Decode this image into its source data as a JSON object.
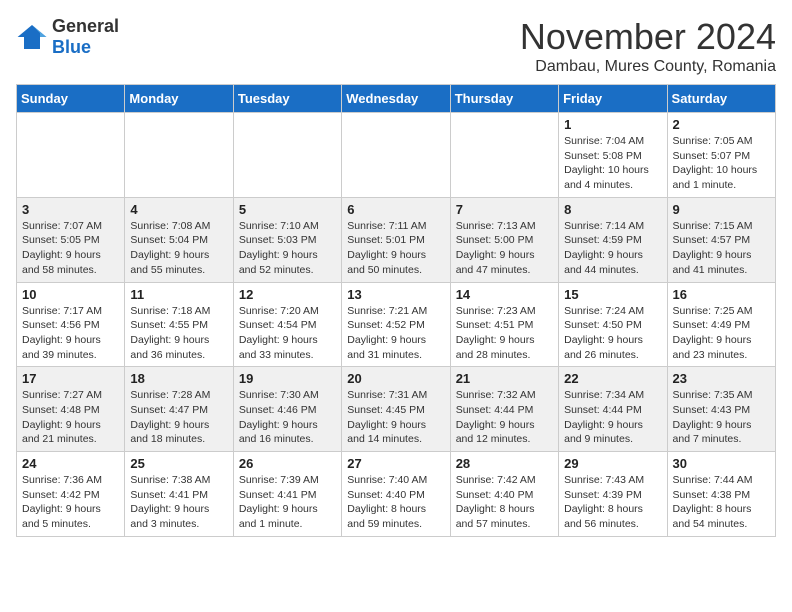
{
  "header": {
    "logo_general": "General",
    "logo_blue": "Blue",
    "month_title": "November 2024",
    "subtitle": "Dambau, Mures County, Romania"
  },
  "weekdays": [
    "Sunday",
    "Monday",
    "Tuesday",
    "Wednesday",
    "Thursday",
    "Friday",
    "Saturday"
  ],
  "weeks": [
    {
      "shaded": false,
      "days": [
        {
          "num": "",
          "detail": "",
          "empty": true
        },
        {
          "num": "",
          "detail": "",
          "empty": true
        },
        {
          "num": "",
          "detail": "",
          "empty": true
        },
        {
          "num": "",
          "detail": "",
          "empty": true
        },
        {
          "num": "",
          "detail": "",
          "empty": true
        },
        {
          "num": "1",
          "detail": "Sunrise: 7:04 AM\nSunset: 5:08 PM\nDaylight: 10 hours and 4 minutes.",
          "empty": false
        },
        {
          "num": "2",
          "detail": "Sunrise: 7:05 AM\nSunset: 5:07 PM\nDaylight: 10 hours and 1 minute.",
          "empty": false
        }
      ]
    },
    {
      "shaded": true,
      "days": [
        {
          "num": "3",
          "detail": "Sunrise: 7:07 AM\nSunset: 5:05 PM\nDaylight: 9 hours and 58 minutes.",
          "empty": false
        },
        {
          "num": "4",
          "detail": "Sunrise: 7:08 AM\nSunset: 5:04 PM\nDaylight: 9 hours and 55 minutes.",
          "empty": false
        },
        {
          "num": "5",
          "detail": "Sunrise: 7:10 AM\nSunset: 5:03 PM\nDaylight: 9 hours and 52 minutes.",
          "empty": false
        },
        {
          "num": "6",
          "detail": "Sunrise: 7:11 AM\nSunset: 5:01 PM\nDaylight: 9 hours and 50 minutes.",
          "empty": false
        },
        {
          "num": "7",
          "detail": "Sunrise: 7:13 AM\nSunset: 5:00 PM\nDaylight: 9 hours and 47 minutes.",
          "empty": false
        },
        {
          "num": "8",
          "detail": "Sunrise: 7:14 AM\nSunset: 4:59 PM\nDaylight: 9 hours and 44 minutes.",
          "empty": false
        },
        {
          "num": "9",
          "detail": "Sunrise: 7:15 AM\nSunset: 4:57 PM\nDaylight: 9 hours and 41 minutes.",
          "empty": false
        }
      ]
    },
    {
      "shaded": false,
      "days": [
        {
          "num": "10",
          "detail": "Sunrise: 7:17 AM\nSunset: 4:56 PM\nDaylight: 9 hours and 39 minutes.",
          "empty": false
        },
        {
          "num": "11",
          "detail": "Sunrise: 7:18 AM\nSunset: 4:55 PM\nDaylight: 9 hours and 36 minutes.",
          "empty": false
        },
        {
          "num": "12",
          "detail": "Sunrise: 7:20 AM\nSunset: 4:54 PM\nDaylight: 9 hours and 33 minutes.",
          "empty": false
        },
        {
          "num": "13",
          "detail": "Sunrise: 7:21 AM\nSunset: 4:52 PM\nDaylight: 9 hours and 31 minutes.",
          "empty": false
        },
        {
          "num": "14",
          "detail": "Sunrise: 7:23 AM\nSunset: 4:51 PM\nDaylight: 9 hours and 28 minutes.",
          "empty": false
        },
        {
          "num": "15",
          "detail": "Sunrise: 7:24 AM\nSunset: 4:50 PM\nDaylight: 9 hours and 26 minutes.",
          "empty": false
        },
        {
          "num": "16",
          "detail": "Sunrise: 7:25 AM\nSunset: 4:49 PM\nDaylight: 9 hours and 23 minutes.",
          "empty": false
        }
      ]
    },
    {
      "shaded": true,
      "days": [
        {
          "num": "17",
          "detail": "Sunrise: 7:27 AM\nSunset: 4:48 PM\nDaylight: 9 hours and 21 minutes.",
          "empty": false
        },
        {
          "num": "18",
          "detail": "Sunrise: 7:28 AM\nSunset: 4:47 PM\nDaylight: 9 hours and 18 minutes.",
          "empty": false
        },
        {
          "num": "19",
          "detail": "Sunrise: 7:30 AM\nSunset: 4:46 PM\nDaylight: 9 hours and 16 minutes.",
          "empty": false
        },
        {
          "num": "20",
          "detail": "Sunrise: 7:31 AM\nSunset: 4:45 PM\nDaylight: 9 hours and 14 minutes.",
          "empty": false
        },
        {
          "num": "21",
          "detail": "Sunrise: 7:32 AM\nSunset: 4:44 PM\nDaylight: 9 hours and 12 minutes.",
          "empty": false
        },
        {
          "num": "22",
          "detail": "Sunrise: 7:34 AM\nSunset: 4:44 PM\nDaylight: 9 hours and 9 minutes.",
          "empty": false
        },
        {
          "num": "23",
          "detail": "Sunrise: 7:35 AM\nSunset: 4:43 PM\nDaylight: 9 hours and 7 minutes.",
          "empty": false
        }
      ]
    },
    {
      "shaded": false,
      "days": [
        {
          "num": "24",
          "detail": "Sunrise: 7:36 AM\nSunset: 4:42 PM\nDaylight: 9 hours and 5 minutes.",
          "empty": false
        },
        {
          "num": "25",
          "detail": "Sunrise: 7:38 AM\nSunset: 4:41 PM\nDaylight: 9 hours and 3 minutes.",
          "empty": false
        },
        {
          "num": "26",
          "detail": "Sunrise: 7:39 AM\nSunset: 4:41 PM\nDaylight: 9 hours and 1 minute.",
          "empty": false
        },
        {
          "num": "27",
          "detail": "Sunrise: 7:40 AM\nSunset: 4:40 PM\nDaylight: 8 hours and 59 minutes.",
          "empty": false
        },
        {
          "num": "28",
          "detail": "Sunrise: 7:42 AM\nSunset: 4:40 PM\nDaylight: 8 hours and 57 minutes.",
          "empty": false
        },
        {
          "num": "29",
          "detail": "Sunrise: 7:43 AM\nSunset: 4:39 PM\nDaylight: 8 hours and 56 minutes.",
          "empty": false
        },
        {
          "num": "30",
          "detail": "Sunrise: 7:44 AM\nSunset: 4:38 PM\nDaylight: 8 hours and 54 minutes.",
          "empty": false
        }
      ]
    }
  ]
}
